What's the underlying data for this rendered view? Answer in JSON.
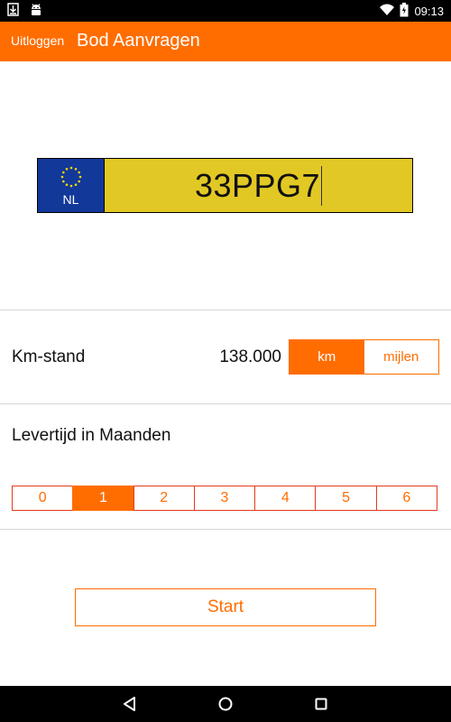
{
  "status_bar": {
    "time": "09:13",
    "icons": [
      "download-icon",
      "android-icon",
      "wifi-icon",
      "battery-icon"
    ]
  },
  "app_bar": {
    "logout_label": "Uitloggen",
    "title": "Bod Aanvragen",
    "color": "#ff6d00"
  },
  "plate": {
    "country": "NL",
    "number": "33PPG7",
    "eu_color": "#12389a",
    "plate_color": "#e2c824"
  },
  "mileage": {
    "label": "Km-stand",
    "value": "138.000",
    "units": [
      {
        "label": "km",
        "selected": true
      },
      {
        "label": "mijlen",
        "selected": false
      }
    ]
  },
  "delivery": {
    "label": "Levertijd in Maanden",
    "options": [
      "0",
      "1",
      "2",
      "3",
      "4",
      "5",
      "6"
    ],
    "selected": "1"
  },
  "start_label": "Start",
  "nav_bar": {
    "icons": [
      "back-icon",
      "home-icon",
      "recents-icon"
    ]
  }
}
